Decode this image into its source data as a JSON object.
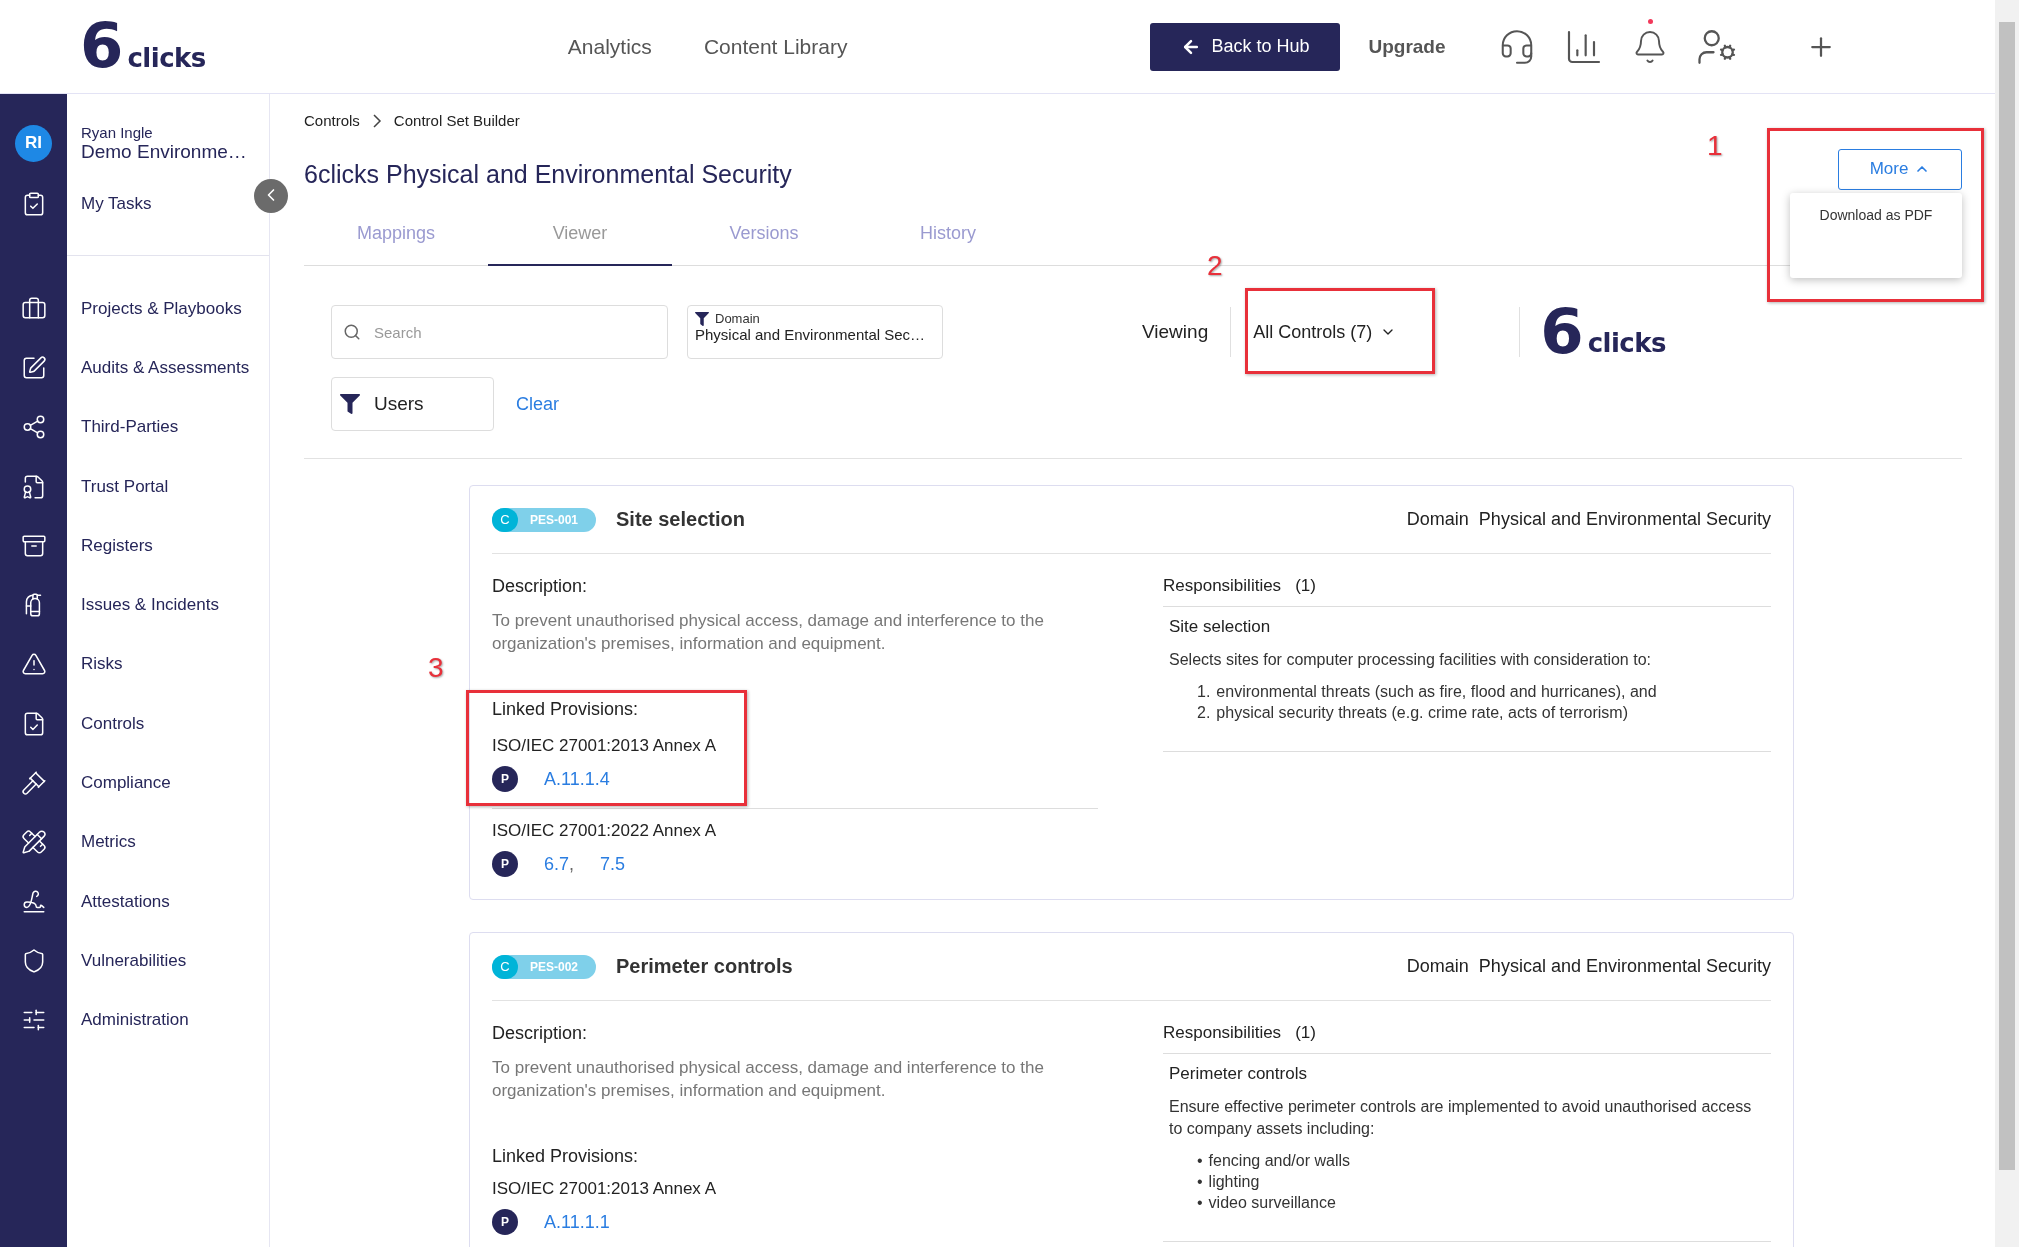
{
  "header": {
    "logo": {
      "mark": "6",
      "word": "clicks"
    },
    "nav": [
      {
        "label": "Analytics"
      },
      {
        "label": "Content Library"
      }
    ],
    "back_button": {
      "label": "Back to Hub"
    },
    "upgrade": {
      "label": "Upgrade"
    },
    "notifications": {
      "unread": true
    }
  },
  "sidebar": {
    "avatar": "RI",
    "user_name": "Ryan Ingle",
    "environment": "Demo Environme…",
    "top_items": [
      {
        "label": "My Tasks"
      }
    ],
    "items": [
      {
        "label": "Projects & Playbooks"
      },
      {
        "label": "Audits & Assessments"
      },
      {
        "label": "Third-Parties"
      },
      {
        "label": "Trust Portal"
      },
      {
        "label": "Registers"
      },
      {
        "label": "Issues & Incidents"
      },
      {
        "label": "Risks"
      },
      {
        "label": "Controls"
      },
      {
        "label": "Compliance"
      },
      {
        "label": "Metrics"
      },
      {
        "label": "Attestations"
      },
      {
        "label": "Vulnerabilities"
      },
      {
        "label": "Administration"
      }
    ]
  },
  "breadcrumb": [
    "Controls",
    "Control Set Builder"
  ],
  "title": "6clicks Physical and Environmental Security",
  "more_button": {
    "label": "More",
    "expanded": true,
    "menu": [
      "Download as PDF"
    ]
  },
  "tabs": [
    {
      "label": "Mappings",
      "selected": false
    },
    {
      "label": "Viewer",
      "selected": true
    },
    {
      "label": "Versions",
      "selected": false
    },
    {
      "label": "History",
      "selected": false
    }
  ],
  "filters": {
    "search": {
      "placeholder": "Search"
    },
    "domain": {
      "label": "Domain",
      "value": "Physical and Environmental Sec…"
    },
    "users": {
      "label": "Users"
    },
    "clear": {
      "label": "Clear"
    },
    "viewing_label": "Viewing",
    "viewing": {
      "value": "All Controls (7)"
    }
  },
  "brand_logo": {
    "mark": "6",
    "word": "clicks"
  },
  "controls": [
    {
      "type_badge": "C",
      "code": "PES-001",
      "title": "Site selection",
      "domain_label": "Domain",
      "domain": "Physical and Environmental Security",
      "description_label": "Description:",
      "description": "To prevent unauthorised physical access, damage and interference to the organization's premises, information and equipment.",
      "linked_label": "Linked Provisions:",
      "provisions": [
        {
          "standard": "ISO/IEC 27001:2013 Annex A",
          "badge": "P",
          "refs": [
            {
              "label": "A.11.1.4"
            }
          ]
        },
        {
          "standard": "ISO/IEC 27001:2022 Annex A",
          "badge": "P",
          "refs": [
            {
              "label": "6.7",
              "suffix": ","
            },
            {
              "label": "7.5"
            }
          ]
        }
      ],
      "responsibilities_label": "Responsibilities",
      "responsibilities_count": "(1)",
      "responsibility": {
        "title": "Site selection",
        "text": "Selects sites for computer processing facilities with consideration to:",
        "list": [
          {
            "marker": "1.",
            "text": "environmental threats (such as fire, flood and hurricanes), and"
          },
          {
            "marker": "2.",
            "text": "physical security threats (e.g. crime rate, acts of terrorism)"
          }
        ]
      }
    },
    {
      "type_badge": "C",
      "code": "PES-002",
      "title": "Perimeter controls",
      "domain_label": "Domain",
      "domain": "Physical and Environmental Security",
      "description_label": "Description:",
      "description": "To prevent unauthorised physical access, damage and interference to the organization's premises, information and equipment.",
      "linked_label": "Linked Provisions:",
      "provisions": [
        {
          "standard": "ISO/IEC 27001:2013 Annex A",
          "badge": "P",
          "refs": [
            {
              "label": "A.11.1.1"
            }
          ]
        }
      ],
      "responsibilities_label": "Responsibilities",
      "responsibilities_count": "(1)",
      "responsibility": {
        "title": "Perimeter controls",
        "text": "Ensure effective perimeter controls are implemented to avoid unauthorised access to company assets including:",
        "list": [
          {
            "marker": "•",
            "text": "fencing and/or walls"
          },
          {
            "marker": "•",
            "text": "lighting"
          },
          {
            "marker": "•",
            "text": "video surveillance"
          }
        ]
      }
    }
  ],
  "annotations": [
    {
      "number": "1"
    },
    {
      "number": "2"
    },
    {
      "number": "3"
    }
  ]
}
